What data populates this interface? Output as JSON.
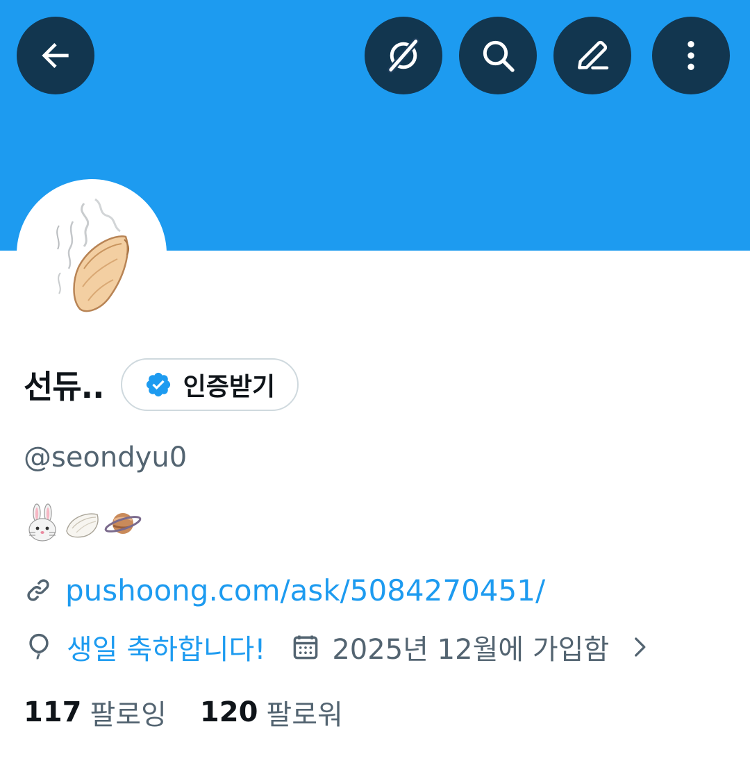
{
  "header": {
    "back_icon": "arrow-left-icon",
    "actions": [
      "grok-icon",
      "search-icon",
      "edit-icon",
      "more-icon"
    ],
    "banner_color": "#1d9bf0"
  },
  "profile": {
    "display_name": "선듀..",
    "verify_label": "인증받기",
    "handle": "@seondyu0",
    "bio_emojis": [
      "rabbit-face",
      "dumpling",
      "ringed-planet"
    ],
    "link": "pushoong.com/ask/5084270451/",
    "birthday_text": "생일 축하합니다!",
    "joined_text": "2025년 12월에 가입함"
  },
  "stats": {
    "following_count": "117",
    "following_label": "팔로잉",
    "followers_count": "120",
    "followers_label": "팔로워"
  },
  "colors": {
    "accent": "#1d9bf0",
    "muted": "#536471",
    "text": "#0f1419"
  }
}
